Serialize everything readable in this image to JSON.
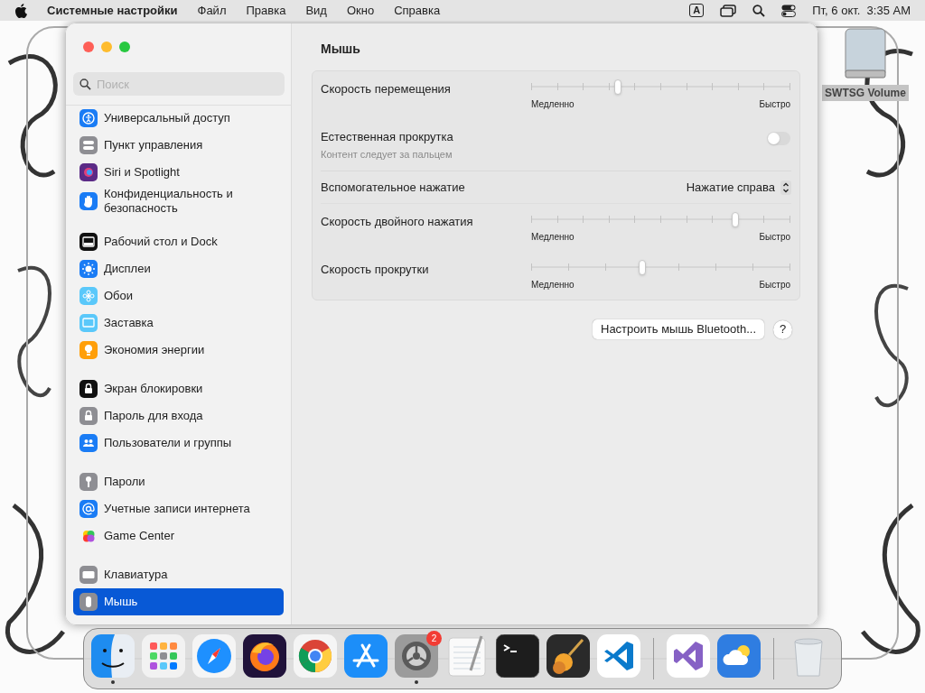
{
  "menu_bar": {
    "app_name": "Системные настройки",
    "menus": [
      "Файл",
      "Правка",
      "Вид",
      "Окно",
      "Справка"
    ],
    "input_source": "A",
    "clock": "Пт, 6 окт.  3:35 AM"
  },
  "desktop_icons": [
    {
      "label": "SWTSG Volume"
    }
  ],
  "window": {
    "title": "Мышь"
  },
  "sidebar": {
    "search": {
      "placeholder": "Поиск"
    },
    "groups": [
      {
        "items": [
          {
            "label": "Универсальный доступ",
            "selected": false
          },
          {
            "label": "Пункт управления",
            "selected": false
          },
          {
            "label": "Siri и Spotlight",
            "selected": false
          },
          {
            "label": "Конфиденциальность и безопасность",
            "selected": false
          }
        ]
      },
      {
        "items": [
          {
            "label": "Рабочий стол и Dock",
            "selected": false
          },
          {
            "label": "Дисплеи",
            "selected": false
          },
          {
            "label": "Обои",
            "selected": false
          },
          {
            "label": "Заставка",
            "selected": false
          },
          {
            "label": "Экономия энергии",
            "selected": false
          }
        ]
      },
      {
        "items": [
          {
            "label": "Экран блокировки",
            "selected": false
          },
          {
            "label": "Пароль для входа",
            "selected": false
          },
          {
            "label": "Пользователи и группы",
            "selected": false
          }
        ]
      },
      {
        "items": [
          {
            "label": "Пароли",
            "selected": false
          },
          {
            "label": "Учетные записи интернета",
            "selected": false
          },
          {
            "label": "Game Center",
            "selected": false
          }
        ]
      },
      {
        "items": [
          {
            "label": "Клавиатура",
            "selected": false
          },
          {
            "label": "Мышь",
            "selected": true
          }
        ]
      }
    ]
  },
  "settings": [
    {
      "kind": "slider",
      "label": "Скорость перемещения",
      "level": 0.336,
      "min_label": "Медленно",
      "max_label": "Быстро"
    },
    {
      "kind": "toggle",
      "label": "Естественная прокрутка",
      "description": "Контент следует за пальцем",
      "on": false
    },
    {
      "kind": "popup",
      "label": "Вспомогательное нажатие",
      "value": "Нажатие справа"
    },
    {
      "kind": "slider",
      "label": "Скорость двойного нажатия",
      "level": 0.79,
      "min_label": "Медленно",
      "max_label": "Быстро"
    },
    {
      "kind": "slider",
      "label": "Скорость прокрутки",
      "level": 0.43,
      "min_label": "Медленно",
      "max_label": "Быстро"
    }
  ],
  "buttons": [
    {
      "kind": "text",
      "label": "Настроить мышь Bluetooth..."
    },
    {
      "kind": "help",
      "label": "?"
    }
  ],
  "dock": {
    "items": [
      {
        "kind": "finder",
        "running": true
      },
      {
        "kind": "launchpad",
        "running": false
      },
      {
        "kind": "safari",
        "running": false
      },
      {
        "kind": "firefox",
        "running": false
      },
      {
        "kind": "chrome",
        "running": false
      },
      {
        "kind": "appstore",
        "running": false
      },
      {
        "kind": "settings",
        "running": true,
        "badge": "2"
      },
      {
        "kind": "textedit",
        "running": false
      },
      {
        "kind": "terminal",
        "running": false
      },
      {
        "kind": "garageband",
        "running": false
      },
      {
        "kind": "vscode",
        "running": false
      },
      {
        "kind": "separator"
      },
      {
        "kind": "visualstudio",
        "running": false
      },
      {
        "kind": "weather",
        "running": false
      },
      {
        "kind": "separator"
      },
      {
        "kind": "trash",
        "running": false
      }
    ]
  }
}
